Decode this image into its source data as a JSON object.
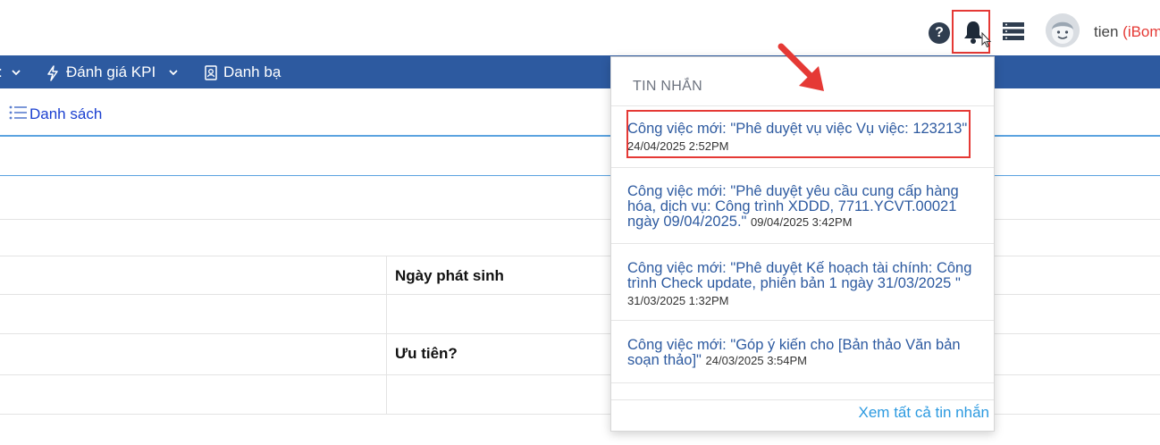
{
  "header": {
    "help_icon": "question-circle-icon",
    "help_glyph": "?",
    "bell_icon": "bell-icon",
    "server_icon": "server-icon",
    "user": {
      "name": "tien",
      "org": "(iBom"
    }
  },
  "nav": {
    "items": [
      {
        "label": ":",
        "icon": "chevron-down-icon"
      },
      {
        "label": "Đánh giá KPI",
        "icon": "bolt-icon"
      },
      {
        "label": "Danh bạ",
        "icon": "contact-book-icon"
      }
    ]
  },
  "toolbar": {
    "list_label": "Danh sách"
  },
  "form": {
    "date_label": "Ngày phát sinh",
    "priority_label": "Ưu tiên?"
  },
  "notifications": {
    "title": "TIN NHẮN",
    "items": [
      {
        "text": "Công việc mới: \"Phê duyệt vụ việc Vụ việc: 123213\"",
        "time": "24/04/2025 2:52PM"
      },
      {
        "text": "Công việc mới: \"Phê duyệt yêu cầu cung cấp hàng hóa, dịch vụ: Công trình XDDD, 7711.YCVT.00021 ngày 09/04/2025.\"",
        "time": "09/04/2025 3:42PM"
      },
      {
        "text": "Công việc mới: \"Phê duyệt Kế hoạch tài chính: Công trình Check update, phiên bản 1 ngày 31/03/2025 \"",
        "time": "31/03/2025 1:32PM"
      },
      {
        "text": "Công việc mới: \"Góp ý kiến cho [Bản thảo Văn bản soạn thảo]\"",
        "time": "24/03/2025 3:54PM"
      }
    ],
    "footer_link": "Xem tất cả tin nhắn"
  },
  "colors": {
    "nav_bg": "#2d5aa0",
    "highlight": "#e53935",
    "link": "#2d5aa0",
    "footer_link": "#2c9ae0"
  }
}
